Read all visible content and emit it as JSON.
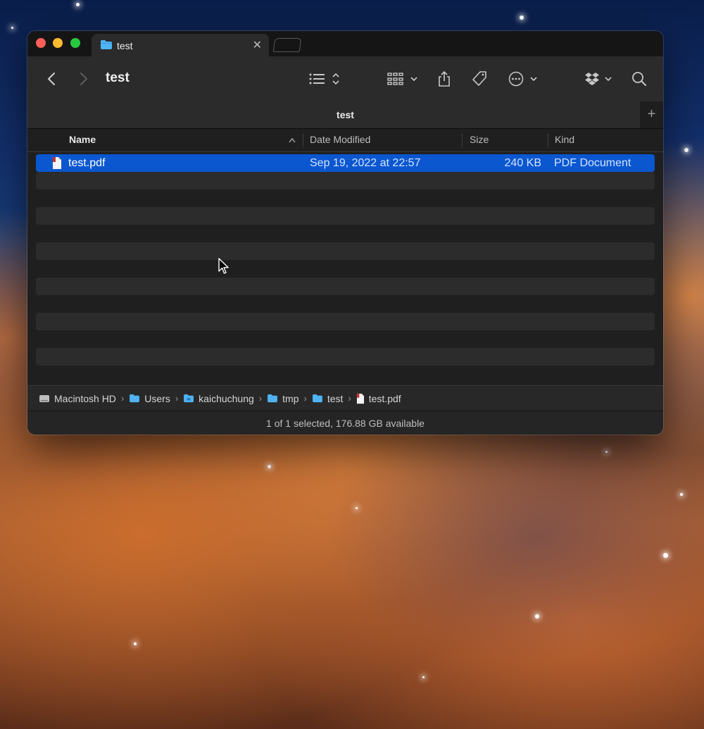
{
  "window": {
    "tab_title": "test",
    "title": "test",
    "path_title": "test"
  },
  "columns": {
    "name": "Name",
    "date_modified": "Date Modified",
    "size": "Size",
    "kind": "Kind"
  },
  "files": [
    {
      "name": "test.pdf",
      "date_modified": "Sep 19, 2022 at 22:57",
      "size": "240 KB",
      "kind": "PDF Document",
      "selected": true
    }
  ],
  "path_bar": [
    {
      "label": "Macintosh HD",
      "icon": "hard-drive-icon"
    },
    {
      "label": "Users",
      "icon": "folder-icon"
    },
    {
      "label": "kaichuchung",
      "icon": "home-folder-icon"
    },
    {
      "label": "tmp",
      "icon": "folder-icon"
    },
    {
      "label": "test",
      "icon": "folder-icon"
    },
    {
      "label": "test.pdf",
      "icon": "pdf-icon"
    }
  ],
  "status": "1 of 1 selected, 176.88 GB available",
  "colors": {
    "selection": "#0a57d0",
    "folder": "#4fb3f3",
    "window_bg": "#1f1f1f"
  }
}
